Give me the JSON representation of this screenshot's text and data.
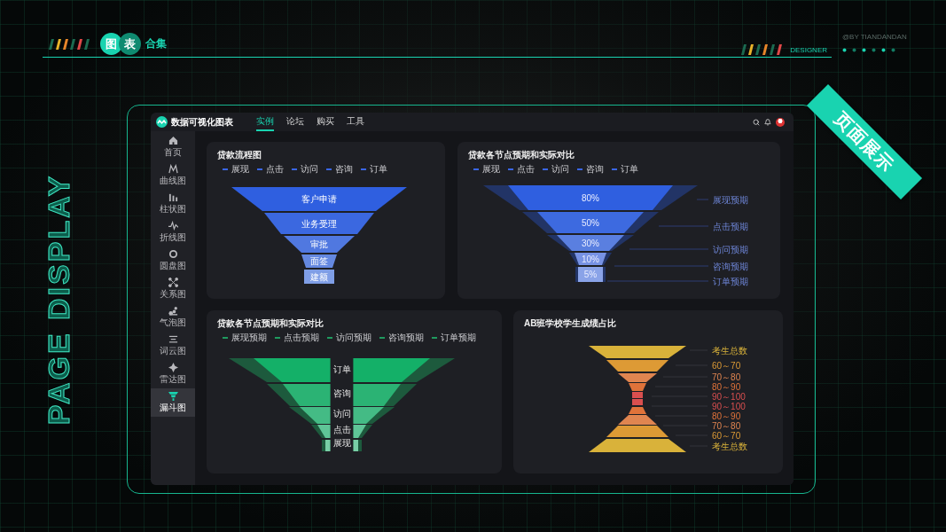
{
  "header": {
    "badges": [
      "图",
      "表"
    ],
    "title": "合集",
    "credit": "@BY TIANDANDAN",
    "tagline": "DESIGNER"
  },
  "side_title": "PAGE DISPLAY",
  "ribbon": "页面展示",
  "app": {
    "name": "数据可视化图表",
    "nav": [
      {
        "label": "实例",
        "selected": true
      },
      {
        "label": "论坛",
        "selected": false
      },
      {
        "label": "购买",
        "selected": false
      },
      {
        "label": "工具",
        "selected": false
      }
    ]
  },
  "sidebar": [
    {
      "label": "首页",
      "kind": "home",
      "selected": false
    },
    {
      "label": "曲线图",
      "kind": "curve",
      "selected": false
    },
    {
      "label": "柱状图",
      "kind": "bars",
      "selected": false
    },
    {
      "label": "折线图",
      "kind": "wave",
      "selected": false
    },
    {
      "label": "圆盘图",
      "kind": "ring",
      "selected": false
    },
    {
      "label": "关系图",
      "kind": "network",
      "selected": false
    },
    {
      "label": "气泡图",
      "kind": "bubble",
      "selected": false
    },
    {
      "label": "词云图",
      "kind": "lines",
      "selected": false
    },
    {
      "label": "雷达图",
      "kind": "radar",
      "selected": false
    },
    {
      "label": "漏斗图",
      "kind": "funnel",
      "selected": true
    }
  ],
  "panels": [
    {
      "kind": "funnel",
      "title": "贷款流程图",
      "legend": [
        "展现",
        "点击",
        "访问",
        "咨询",
        "订单"
      ],
      "stages": [
        "客户申请",
        "业务受理",
        "审批",
        "面签",
        "建额"
      ]
    },
    {
      "kind": "compare",
      "title": "贷款各节点预期和实际对比",
      "legend": [
        "展现",
        "点击",
        "访问",
        "咨询",
        "订单"
      ],
      "stages": [
        "80%",
        "50%",
        "30%",
        "10%",
        "5%"
      ],
      "callouts": [
        "展现预期",
        "点击预期",
        "访问预期",
        "咨询预期",
        "订单预期"
      ]
    },
    {
      "kind": "mirror",
      "title": "贷款各节点预期和实际对比",
      "legend": [
        "展现预期",
        "点击预期",
        "访问预期",
        "咨询预期",
        "订单预期"
      ],
      "stages": [
        "订单",
        "咨询",
        "访问",
        "点击",
        "展现"
      ]
    },
    {
      "kind": "hourglass",
      "title": "AB班学校学生成绩占比",
      "stages": [
        {
          "label": "考生总数",
          "color": "#d9b23a"
        },
        {
          "label": "60～70",
          "color": "#dd9a35"
        },
        {
          "label": "70～80",
          "color": "#e08550"
        },
        {
          "label": "80～90",
          "color": "#e0733a"
        },
        {
          "label": "90～100",
          "color": "#d94f4f"
        },
        {
          "label": "90～100",
          "color": "#d94f4f"
        },
        {
          "label": "80～90",
          "color": "#e0733a"
        },
        {
          "label": "70～80",
          "color": "#e08550"
        },
        {
          "label": "60～70",
          "color": "#dd9a35"
        },
        {
          "label": "考生总数",
          "color": "#d9b23a"
        }
      ]
    }
  ]
}
